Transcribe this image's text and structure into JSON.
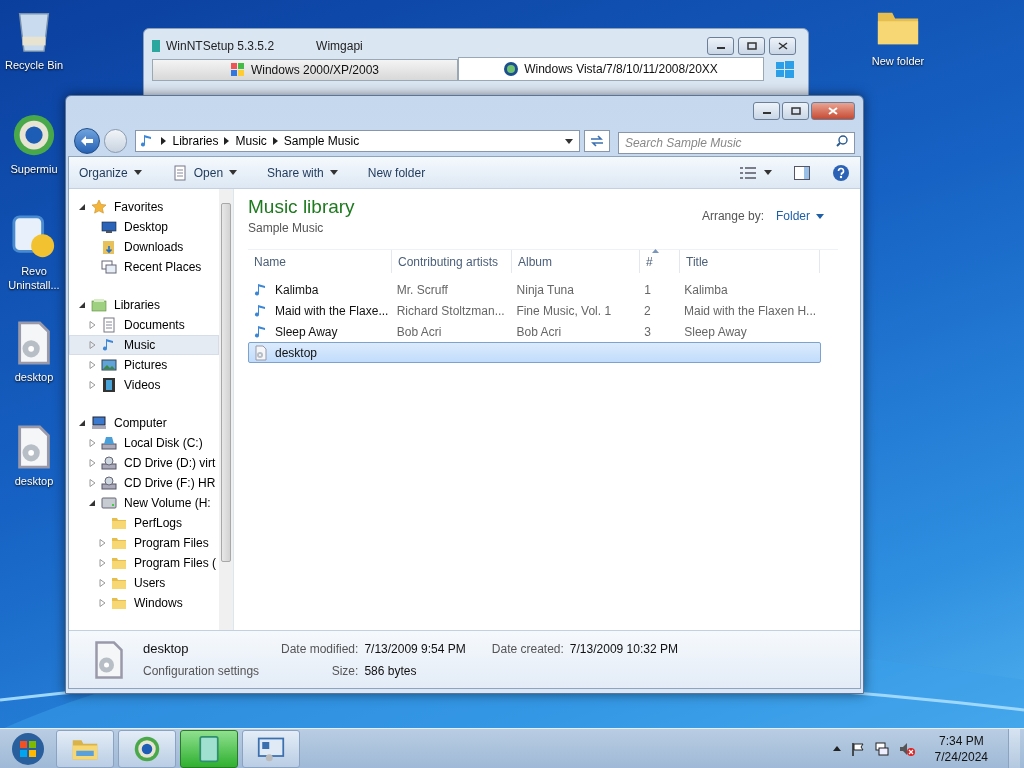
{
  "desktop_icons": [
    {
      "label": "Recycle Bin",
      "kind": "bin"
    },
    {
      "label": "Supermiu",
      "kind": "browser"
    },
    {
      "label": "Revo Uninstall...",
      "kind": "uninstaller"
    },
    {
      "label": "desktop",
      "kind": "config"
    },
    {
      "label": "desktop",
      "kind": "config"
    },
    {
      "label": "New folder",
      "kind": "folder"
    }
  ],
  "setup_window": {
    "title": "WinNTSetup 5.3.5.2",
    "subtitle": "Wimgapi",
    "tabs": [
      {
        "label": "Windows 2000/XP/2003",
        "selected": false
      },
      {
        "label": "Windows Vista/7/8/10/11/2008/20XX",
        "selected": true
      }
    ]
  },
  "explorer": {
    "breadcrumb": [
      "Libraries",
      "Music",
      "Sample Music"
    ],
    "search": {
      "placeholder": "Search Sample Music"
    },
    "toolbar": [
      {
        "label": "Organize",
        "dropdown": true,
        "kind": "plain"
      },
      {
        "label": "Open",
        "dropdown": true,
        "kind": "open"
      },
      {
        "label": "Share with",
        "dropdown": true,
        "kind": "plain"
      },
      {
        "label": "New folder",
        "dropdown": false,
        "kind": "plain"
      }
    ],
    "navigation": [
      {
        "label": "Favorites",
        "kind": "star",
        "expanded": true,
        "selected": false,
        "children": [
          {
            "label": "Desktop",
            "kind": "desktop",
            "selected": false
          },
          {
            "label": "Downloads",
            "kind": "downloads",
            "selected": false
          },
          {
            "label": "Recent Places",
            "kind": "recent",
            "selected": false
          }
        ]
      },
      {
        "label": "Libraries",
        "kind": "library",
        "expanded": true,
        "selected": false,
        "children": [
          {
            "label": "Documents",
            "kind": "document",
            "expanded": false,
            "selected": false
          },
          {
            "label": "Music",
            "kind": "music",
            "expanded": false,
            "selected": true
          },
          {
            "label": "Pictures",
            "kind": "pictures",
            "expanded": false,
            "selected": false
          },
          {
            "label": "Videos",
            "kind": "videos",
            "expanded": false,
            "selected": false
          }
        ]
      },
      {
        "label": "Computer",
        "kind": "computer",
        "expanded": true,
        "selected": false,
        "children": [
          {
            "label": "Local Disk (C:)",
            "kind": "disk",
            "expanded": false,
            "selected": false
          },
          {
            "label": "CD Drive (D:) virt",
            "kind": "cd",
            "expanded": false,
            "selected": false
          },
          {
            "label": "CD Drive (F:) HR",
            "kind": "cd",
            "expanded": false,
            "selected": false
          },
          {
            "label": "New Volume (H:",
            "kind": "volume",
            "expanded": true,
            "selected": false,
            "children": [
              {
                "label": "PerfLogs",
                "kind": "folder",
                "selected": false
              },
              {
                "label": "Program Files",
                "kind": "folder",
                "expanded": false,
                "selected": false
              },
              {
                "label": "Program Files (",
                "kind": "folder",
                "expanded": false,
                "selected": false
              },
              {
                "label": "Users",
                "kind": "folder",
                "expanded": false,
                "selected": false
              },
              {
                "label": "Windows",
                "kind": "folder",
                "expanded": false,
                "selected": false
              }
            ]
          }
        ]
      }
    ],
    "library": {
      "title": "Music library",
      "subtitle": "Sample Music",
      "arrange_label": "Arrange by:",
      "arrange_value": "Folder"
    },
    "columns": [
      "Name",
      "Contributing artists",
      "Album",
      "#",
      "Title"
    ],
    "rows": [
      {
        "kind": "music",
        "selected": false,
        "cells": [
          "Kalimba",
          "Mr. Scruff",
          "Ninja Tuna",
          "1",
          "Kalimba"
        ]
      },
      {
        "kind": "music",
        "selected": false,
        "cells": [
          "Maid with the Flaxe...",
          "Richard Stoltzman...",
          "Fine Music, Vol. 1",
          "2",
          "Maid with the Flaxen H..."
        ]
      },
      {
        "kind": "music",
        "selected": false,
        "cells": [
          "Sleep Away",
          "Bob Acri",
          "Bob Acri",
          "3",
          "Sleep Away"
        ]
      },
      {
        "kind": "config",
        "selected": true,
        "cells": [
          "desktop"
        ]
      }
    ],
    "details": {
      "name": "desktop",
      "type": "Configuration settings",
      "fields": [
        {
          "label": "Date modified:",
          "value": "7/13/2009 9:54 PM"
        },
        {
          "label": "Size:",
          "value": "586 bytes"
        },
        {
          "label": "Date created:",
          "value": "7/13/2009 10:32 PM"
        }
      ]
    }
  },
  "taskbar": {
    "apps": [
      {
        "kind": "explorer",
        "active": false
      },
      {
        "kind": "browser",
        "active": false
      },
      {
        "kind": "green",
        "active": true
      },
      {
        "kind": "setup",
        "active": false
      }
    ],
    "time": "7:34 PM",
    "date": "7/24/2024"
  }
}
